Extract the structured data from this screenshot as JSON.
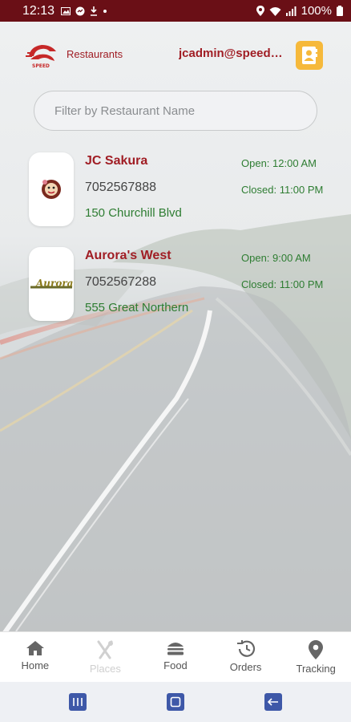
{
  "status_bar": {
    "time": "12:13",
    "battery": "100%"
  },
  "header": {
    "logo_text": "SPEED",
    "page_title": "Restaurants",
    "user_email": "jcadmin@speedychef.ca"
  },
  "search": {
    "placeholder": "Filter by Restaurant Name",
    "value": ""
  },
  "restaurants": [
    {
      "name": "JC Sakura",
      "phone": "7052567888",
      "address": "150 Churchill Blvd",
      "open": "Open: 12:00 AM",
      "closed": "Closed: 11:00 PM"
    },
    {
      "name": "Aurora's West",
      "phone": "7052567288",
      "address": "555 Great Northern",
      "open": "Open: 9:00 AM",
      "closed": "Closed: 11:00 PM",
      "logo_text": "Aurora"
    }
  ],
  "bottom_nav": {
    "items": [
      {
        "label": "Home",
        "icon": "home-icon",
        "active": true
      },
      {
        "label": "Places",
        "icon": "utensils-icon",
        "active": false
      },
      {
        "label": "Food",
        "icon": "burger-icon",
        "active": true
      },
      {
        "label": "Orders",
        "icon": "history-icon",
        "active": true
      },
      {
        "label": "Tracking",
        "icon": "location-pin-icon",
        "active": true
      }
    ]
  },
  "colors": {
    "status_bar": "#6a0f16",
    "brand_red": "#a01d24",
    "green": "#2e7d32",
    "profile_button": "#f6b93b",
    "system_nav_icon": "#3e58a8"
  }
}
